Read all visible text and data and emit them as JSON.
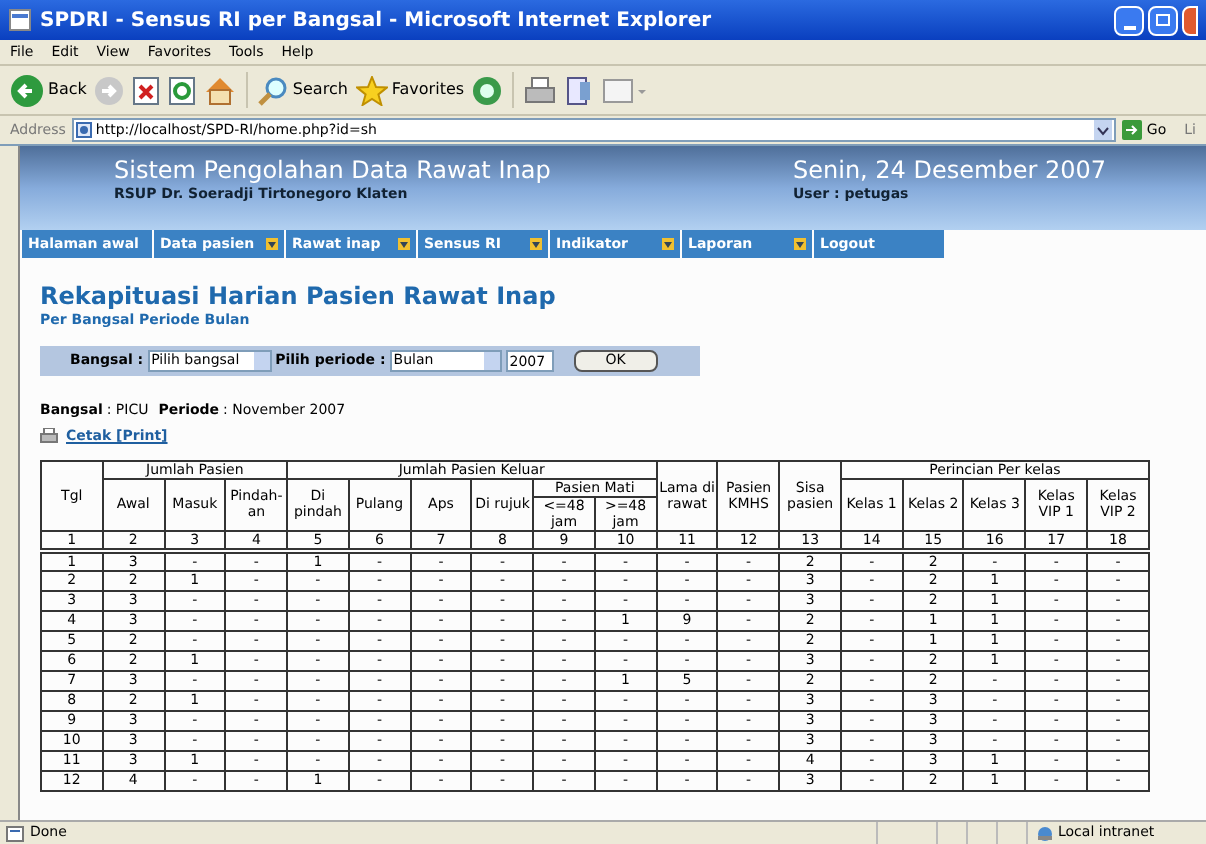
{
  "window": {
    "title": "SPDRI - Sensus RI per Bangsal - Microsoft Internet Explorer"
  },
  "menu": [
    "File",
    "Edit",
    "View",
    "Favorites",
    "Tools",
    "Help"
  ],
  "toolbar": [
    {
      "kind": "back",
      "label": "Back"
    },
    {
      "kind": "forward"
    },
    {
      "kind": "stop"
    },
    {
      "kind": "refresh"
    },
    {
      "kind": "home"
    },
    {
      "kind": "search",
      "label": "Search"
    },
    {
      "kind": "favorites",
      "label": "Favorites"
    },
    {
      "kind": "media"
    },
    {
      "kind": "print"
    },
    {
      "kind": "edit"
    },
    {
      "kind": "messenger"
    }
  ],
  "address": {
    "label": "Address",
    "value": "http://localhost/SPD-RI/home.php?id=sh",
    "go": "Go",
    "links": "Li"
  },
  "banner": {
    "title": "Sistem Pengolahan Data Rawat Inap",
    "subtitle": "RSUP Dr. Soeradji Tirtonegoro Klaten",
    "date": "Senin, 24 Desember 2007",
    "user": "User : petugas"
  },
  "nav": [
    {
      "label": "Halaman awal",
      "dropdown": false
    },
    {
      "label": "Data pasien",
      "dropdown": true
    },
    {
      "label": "Rawat inap",
      "dropdown": true
    },
    {
      "label": "Sensus RI",
      "dropdown": true
    },
    {
      "label": "Indikator",
      "dropdown": true
    },
    {
      "label": "Laporan",
      "dropdown": true
    },
    {
      "label": "Logout",
      "dropdown": false
    }
  ],
  "heading": {
    "title": "Rekapituasi Harian Pasien Rawat Inap",
    "subtitle": "Per Bangsal Periode Bulan"
  },
  "filter": {
    "bangsal_label": "Bangsal :",
    "bangsal_value": "Pilih bangsal",
    "periode_label": "Pilih periode :",
    "periode_value": "Bulan",
    "year": "2007",
    "ok": "OK"
  },
  "info": {
    "bangsal_label": "Bangsal",
    "bangsal_value": ": PICU",
    "periode_label": "Periode",
    "periode_value": ": November 2007"
  },
  "print_link": "Cetak [Print]",
  "table": {
    "header_rows": [
      [
        {
          "label": "Tgl",
          "rowspan": 3
        },
        {
          "label": "Jumlah Pasien",
          "colspan": 3
        },
        {
          "label": "Jumlah Pasien Keluar",
          "colspan": 6
        },
        {
          "label": "Lama di rawat",
          "rowspan": 3
        },
        {
          "label": "Pasien KMHS",
          "rowspan": 3
        },
        {
          "label": "Sisa pasien",
          "rowspan": 3
        },
        {
          "label": "Perincian Per kelas",
          "colspan": 5
        }
      ],
      [
        {
          "label": "Awal",
          "rowspan": 2
        },
        {
          "label": "Masuk",
          "rowspan": 2
        },
        {
          "label": "Pindah-an",
          "rowspan": 2
        },
        {
          "label": "Di pindah",
          "rowspan": 2
        },
        {
          "label": "Pulang",
          "rowspan": 2
        },
        {
          "label": "Aps",
          "rowspan": 2
        },
        {
          "label": "Di rujuk",
          "rowspan": 2
        },
        {
          "label": "Pasien Mati",
          "colspan": 2
        },
        {
          "label": "Kelas 1",
          "rowspan": 2
        },
        {
          "label": "Kelas 2",
          "rowspan": 2
        },
        {
          "label": "Kelas 3",
          "rowspan": 2
        },
        {
          "label": "Kelas VIP 1",
          "rowspan": 2
        },
        {
          "label": "Kelas VIP 2",
          "rowspan": 2
        }
      ],
      [
        {
          "label": "<=48 jam"
        },
        {
          "label": ">=48 jam"
        }
      ]
    ],
    "numbers": [
      "1",
      "2",
      "3",
      "4",
      "5",
      "6",
      "7",
      "8",
      "9",
      "10",
      "11",
      "12",
      "13",
      "14",
      "15",
      "16",
      "17",
      "18"
    ],
    "rows": [
      {
        "tgl": "1",
        "cells": [
          "3",
          "-",
          "-",
          "1",
          "-",
          "-",
          "-",
          "-",
          "-",
          "-",
          "-",
          "2",
          "-",
          "2",
          "-",
          "-",
          "-"
        ]
      },
      {
        "tgl": "2",
        "cells": [
          "2",
          "1",
          "-",
          "-",
          "-",
          "-",
          "-",
          "-",
          "-",
          "-",
          "-",
          "3",
          "-",
          "2",
          "1",
          "-",
          "-"
        ]
      },
      {
        "tgl": "3",
        "cells": [
          "3",
          "-",
          "-",
          "-",
          "-",
          "-",
          "-",
          "-",
          "-",
          "-",
          "-",
          "3",
          "-",
          "2",
          "1",
          "-",
          "-"
        ]
      },
      {
        "tgl": "4",
        "cells": [
          "3",
          "-",
          "-",
          "-",
          "-",
          "-",
          "-",
          "-",
          "1",
          "9",
          "-",
          "2",
          "-",
          "1",
          "1",
          "-",
          "-"
        ]
      },
      {
        "tgl": "5",
        "cells": [
          "2",
          "-",
          "-",
          "-",
          "-",
          "-",
          "-",
          "-",
          "-",
          "-",
          "-",
          "2",
          "-",
          "1",
          "1",
          "-",
          "-"
        ]
      },
      {
        "tgl": "6",
        "cells": [
          "2",
          "1",
          "-",
          "-",
          "-",
          "-",
          "-",
          "-",
          "-",
          "-",
          "-",
          "3",
          "-",
          "2",
          "1",
          "-",
          "-"
        ]
      },
      {
        "tgl": "7",
        "cells": [
          "3",
          "-",
          "-",
          "-",
          "-",
          "-",
          "-",
          "-",
          "1",
          "5",
          "-",
          "2",
          "-",
          "2",
          "-",
          "-",
          "-"
        ]
      },
      {
        "tgl": "8",
        "cells": [
          "2",
          "1",
          "-",
          "-",
          "-",
          "-",
          "-",
          "-",
          "-",
          "-",
          "-",
          "3",
          "-",
          "3",
          "-",
          "-",
          "-"
        ]
      },
      {
        "tgl": "9",
        "cells": [
          "3",
          "-",
          "-",
          "-",
          "-",
          "-",
          "-",
          "-",
          "-",
          "-",
          "-",
          "3",
          "-",
          "3",
          "-",
          "-",
          "-"
        ]
      },
      {
        "tgl": "10",
        "cells": [
          "3",
          "-",
          "-",
          "-",
          "-",
          "-",
          "-",
          "-",
          "-",
          "-",
          "-",
          "3",
          "-",
          "3",
          "-",
          "-",
          "-"
        ]
      },
      {
        "tgl": "11",
        "cells": [
          "3",
          "1",
          "-",
          "-",
          "-",
          "-",
          "-",
          "-",
          "-",
          "-",
          "-",
          "4",
          "-",
          "3",
          "1",
          "-",
          "-"
        ]
      },
      {
        "tgl": "12",
        "cells": [
          "4",
          "-",
          "-",
          "1",
          "-",
          "-",
          "-",
          "-",
          "-",
          "-",
          "-",
          "3",
          "-",
          "2",
          "1",
          "-",
          "-"
        ]
      }
    ]
  },
  "status_bar": {
    "text": "Done",
    "zone": "Local intranet"
  }
}
